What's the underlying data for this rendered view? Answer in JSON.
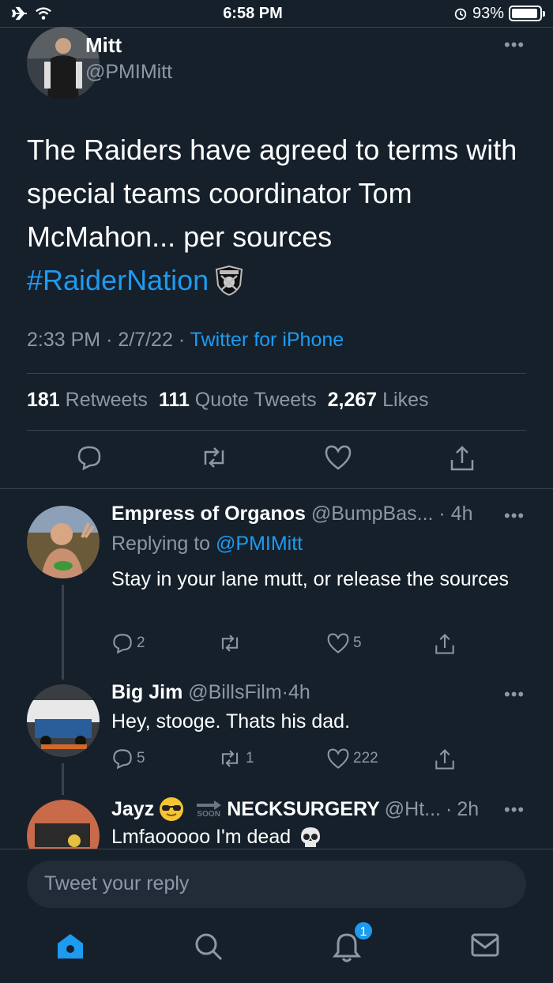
{
  "status_bar": {
    "time": "6:58 PM",
    "battery": "93%",
    "battery_level": 0.93
  },
  "main_tweet": {
    "author_name": "Mitt",
    "author_handle": "@PMIMitt",
    "text_lines": [
      "The Raiders have agreed to terms with",
      "special teams coordinator Tom",
      "McMahon...  per sources"
    ],
    "hashtag": "#RaiderNation",
    "time": "2:33 PM",
    "date": "2/7/22",
    "source": "Twitter for iPhone",
    "stats": {
      "retweets_count": "181",
      "retweets_label": "Retweets",
      "quotes_count": "111",
      "quotes_label": "Quote Tweets",
      "likes_count": "2,267",
      "likes_label": "Likes"
    }
  },
  "replies": [
    {
      "name": "Empress of Organos",
      "handle": "@BumpBas...",
      "age": "4h",
      "replying_prefix": "Replying to",
      "replying_to": "@PMIMitt",
      "text": "Stay in your lane mutt, or release the sources",
      "reply_count": "2",
      "retweet_count": "",
      "like_count": "5"
    },
    {
      "name": "Big Jim",
      "handle": "@BillsFilm",
      "age": "4h",
      "text": "Hey, stooge. Thats his dad.",
      "reply_count": "5",
      "retweet_count": "1",
      "like_count": "222"
    },
    {
      "name": "Jayz",
      "name_suffix": "NECKSURGERY",
      "soon_label": "SOON",
      "handle": "@Ht...",
      "age": "2h",
      "text": "Lmfaooooo I'm dead"
    }
  ],
  "reply_box": {
    "placeholder": "Tweet your reply"
  },
  "tab_bar": {
    "notifications_badge": "1"
  },
  "icons": {
    "home": "home-icon",
    "search": "search-icon",
    "notifications": "bell-icon",
    "messages": "mail-icon"
  },
  "colors": {
    "background": "#15202b",
    "accent": "#1d9bf0",
    "secondary_text": "#8b98a5"
  }
}
